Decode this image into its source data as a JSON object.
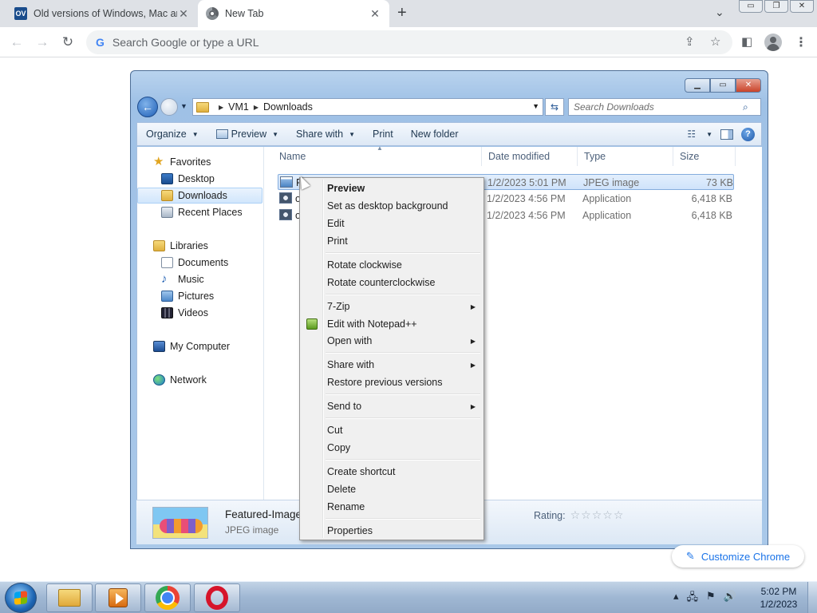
{
  "chrome": {
    "tabs": [
      {
        "title": "Old versions of Windows, Mac ar",
        "favicon": "ov-favicon",
        "favicon_text": "OV"
      },
      {
        "title": "New Tab",
        "favicon": "chrome-favicon"
      }
    ],
    "tab_close_glyph": "✕",
    "new_tab_glyph": "+",
    "tab_search_glyph": "⌄",
    "window_controls": [
      "▭",
      "❐",
      "✕"
    ],
    "omnibox_placeholder": "Search Google or type a URL",
    "customize_label": "Customize Chrome"
  },
  "explorer": {
    "breadcrumb": [
      "VM1",
      "Downloads"
    ],
    "search_placeholder": "Search Downloads",
    "commands": [
      {
        "label": "Organize",
        "dropdown": true
      },
      {
        "label": "Preview",
        "dropdown": true
      },
      {
        "label": "Share with",
        "dropdown": true
      },
      {
        "label": "Print",
        "dropdown": false
      },
      {
        "label": "New folder",
        "dropdown": false
      }
    ],
    "nav": {
      "favorites": "Favorites",
      "desktop": "Desktop",
      "downloads": "Downloads",
      "recent": "Recent Places",
      "libraries": "Libraries",
      "documents": "Documents",
      "music": "Music",
      "pictures": "Pictures",
      "videos": "Videos",
      "computer": "My Computer",
      "network": "Network"
    },
    "columns": {
      "name": "Name",
      "date": "Date modified",
      "type": "Type",
      "size": "Size"
    },
    "files": [
      {
        "name": "F",
        "date": "1/2/2023 5:01 PM",
        "type": "JPEG image",
        "size": "73 KB",
        "selected": true
      },
      {
        "name": "o",
        "date": "1/2/2023 4:56 PM",
        "type": "Application",
        "size": "6,418 KB",
        "selected": false
      },
      {
        "name": "o",
        "date": "1/2/2023 4:56 PM",
        "type": "Application",
        "size": "6,418 KB",
        "selected": false
      }
    ],
    "details": {
      "name": "Featured-Image",
      "type": "JPEG image",
      "rating_label": "Rating:",
      "rating_stars": "☆☆☆☆☆"
    }
  },
  "context_menu": {
    "preview": "Preview",
    "set_desktop": "Set as desktop background",
    "edit": "Edit",
    "print": "Print",
    "rotate_cw": "Rotate clockwise",
    "rotate_ccw": "Rotate counterclockwise",
    "seven_zip": "7-Zip",
    "edit_npp": "Edit with Notepad++",
    "open_with": "Open with",
    "share_with": "Share with",
    "restore_versions": "Restore previous versions",
    "send_to": "Send to",
    "cut": "Cut",
    "copy": "Copy",
    "create_shortcut": "Create shortcut",
    "delete": "Delete",
    "rename": "Rename",
    "properties": "Properties"
  },
  "taskbar": {
    "time": "5:02 PM",
    "date": "1/2/2023"
  }
}
